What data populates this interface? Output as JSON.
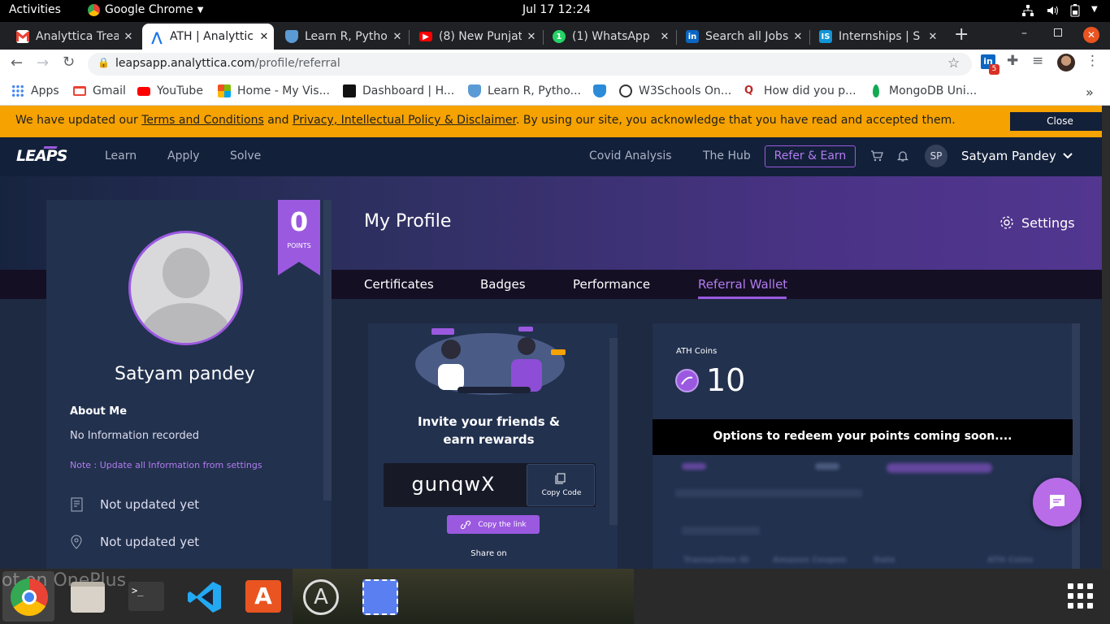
{
  "system_bar": {
    "activities": "Activities",
    "app_name": "Google Chrome",
    "datetime": "Jul 17  12:24"
  },
  "browser": {
    "tabs": [
      {
        "title": "Analyttica Trea",
        "favicon": "gmail-icon",
        "color": "#ea4335"
      },
      {
        "title": "ATH | Analyttic",
        "favicon": "ath-icon",
        "color": "#1a73e8",
        "active": true
      },
      {
        "title": "Learn R, Pytho",
        "favicon": "shield-icon",
        "color": "#5b9bd5"
      },
      {
        "title": "(8) New Punjat",
        "favicon": "youtube-icon",
        "color": "#ff0000"
      },
      {
        "title": "(1) WhatsApp",
        "favicon": "whatsapp-icon",
        "color": "#25d366"
      },
      {
        "title": "Search all Jobs",
        "favicon": "linkedin-icon",
        "color": "#0a66c2"
      },
      {
        "title": "Internships | S",
        "favicon": "internshala-icon",
        "color": "#1295d8"
      }
    ],
    "url_host": "leapsapp.analyttica.com",
    "url_path": "/profile/referral",
    "linkedin_badge": "5",
    "bookmarks": [
      {
        "label": "Apps",
        "icon": "apps-grid-icon",
        "color": "#4285f4"
      },
      {
        "label": "Gmail",
        "icon": "gmail-icon",
        "color": "#ea4335"
      },
      {
        "label": "YouTube",
        "icon": "youtube-icon",
        "color": "#ff0000"
      },
      {
        "label": "Home - My Vis...",
        "icon": "microsoft-icon",
        "color": "#f25022"
      },
      {
        "label": "Dashboard | H...",
        "icon": "hackerrank-icon",
        "color": "#111111"
      },
      {
        "label": "Learn R, Pytho...",
        "icon": "shield-icon",
        "color": "#5b9bd5"
      },
      {
        "label": "",
        "icon": "shield-icon",
        "color": "#2b8bd8"
      },
      {
        "label": "W3Schools On...",
        "icon": "globe-icon",
        "color": "#333333"
      },
      {
        "label": "How did you p...",
        "icon": "quora-icon",
        "color": "#b92b27"
      },
      {
        "label": "MongoDB Uni...",
        "icon": "mongodb-leaf-icon",
        "color": "#13aa52"
      }
    ]
  },
  "notice": {
    "prefix": "We have updated our ",
    "link1": "Terms and Conditions",
    "mid": " and ",
    "link2": "Privacy, Intellectual Policy & Disclaimer",
    "suffix": ". By using our site, you acknowledge that you have read and accepted them.",
    "close_label": "Close"
  },
  "nav": {
    "logo": "LEAPS",
    "links": [
      "Learn",
      "Apply",
      "Solve"
    ],
    "right_links": [
      "Covid Analysis",
      "The Hub"
    ],
    "refer_label": "Refer & Earn",
    "avatar_initials": "SP",
    "user_name": "Satyam Pandey"
  },
  "profile_card": {
    "points_value": "0",
    "points_label": "POINTS",
    "name": "Satyam pandey",
    "about_heading": "About Me",
    "about_text": "No Information recorded",
    "note": "Note : Update all Information from settings",
    "detail_1": "Not updated yet",
    "detail_2": "Not updated yet"
  },
  "main": {
    "title": "My Profile",
    "settings_label": "Settings",
    "tabs": [
      "Certificates",
      "Badges",
      "Performance",
      "Referral Wallet"
    ],
    "active_tab": "Referral Wallet"
  },
  "invite_card": {
    "heading_line1": "Invite your friends &",
    "heading_line2": "earn rewards",
    "code": "gunqwX",
    "copy_code_label": "Copy Code",
    "copy_link_label": "Copy the link",
    "share_label": "Share on"
  },
  "wallet_card": {
    "coins_label": "ATH Coins",
    "coins_value": "10",
    "coming_soon": "Options to redeem your points coming soon....",
    "blurred_headers": [
      "Transaction ID",
      "Amazon Coupon",
      "Date",
      "ATH Coins"
    ]
  },
  "colors": {
    "accent_purple": "#9b59e0",
    "notice_bg": "#f6a200",
    "nav_bg": "#13203a"
  },
  "dock_apps": [
    "chrome-icon",
    "files-icon",
    "terminal-icon",
    "vscode-icon",
    "software-store-icon",
    "app-updater-icon",
    "screenshot-icon",
    "show-apps-icon"
  ],
  "desktop_text": "ot on OnePlus"
}
